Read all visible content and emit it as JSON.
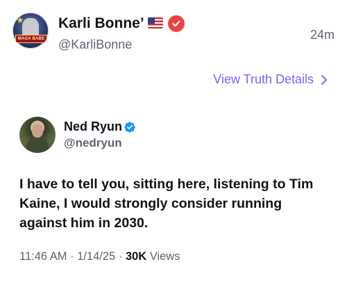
{
  "post": {
    "author_name": "Karli Bonne’",
    "author_handle": "@KarliBonne",
    "time_ago": "24m",
    "avatar_text": "MAGA BABE",
    "view_details_label": "View Truth Details"
  },
  "quoted": {
    "author_name": "Ned Ryun",
    "author_handle": "@nedryun",
    "text": "I have to tell you, sitting here, listening to Tim Kaine, I would strongly consider running against him in 2030.",
    "time": "11:46 AM",
    "date": "1/14/25",
    "views_count": "30K",
    "views_label": "Views"
  },
  "colors": {
    "accent": "#7469f4",
    "truth_badge": "#ec4346",
    "twitter_verified": "#1d9bf0",
    "muted_text": "#5b6470"
  },
  "icons": [
    "us-flag-icon",
    "truth-verified-icon",
    "chevron-right-icon",
    "twitter-verified-icon"
  ]
}
